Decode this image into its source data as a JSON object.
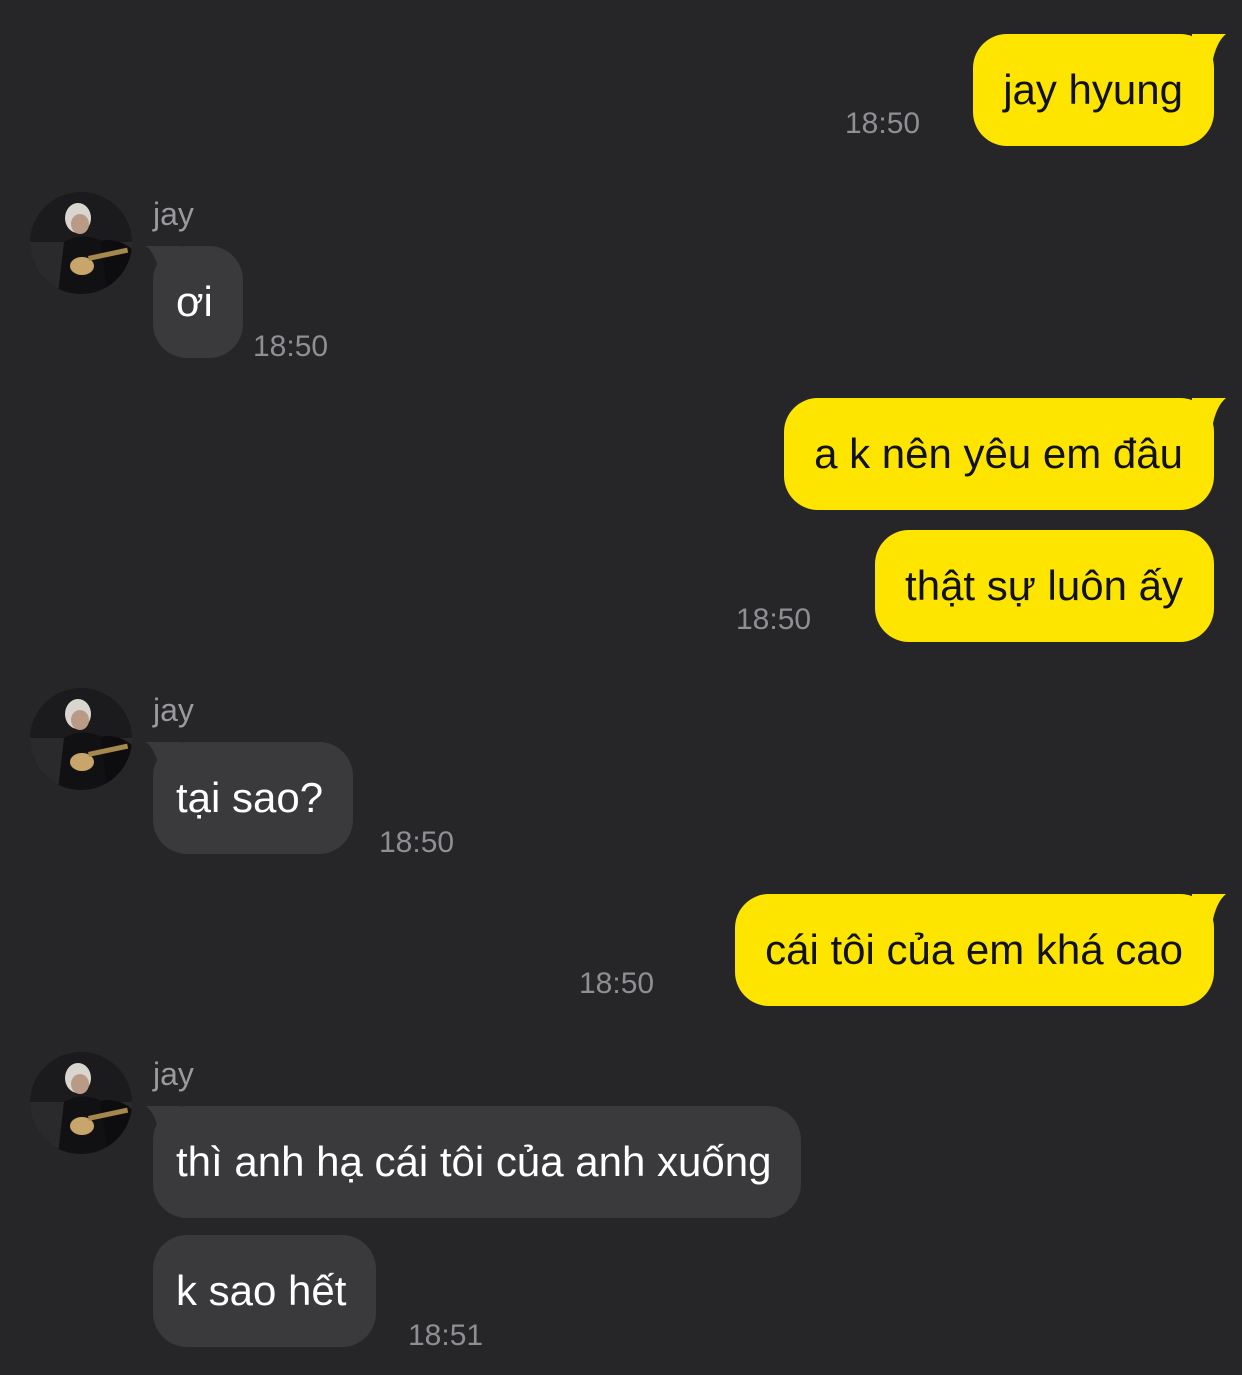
{
  "contact": {
    "name": "jay"
  },
  "messages": [
    {
      "side": "sent",
      "text": "jay hyung",
      "time": "18:50"
    },
    {
      "side": "received",
      "text": "ơi",
      "time": "18:50"
    },
    {
      "side": "sent",
      "text": "a k nên yêu em đâu"
    },
    {
      "side": "sent",
      "text": "thật sự luôn ấy",
      "time": "18:50"
    },
    {
      "side": "received",
      "text": "tại sao?",
      "time": "18:50"
    },
    {
      "side": "sent",
      "text": "cái tôi của em khá cao",
      "time": "18:50"
    },
    {
      "side": "received",
      "text": "thì anh hạ cái tôi của anh xuống"
    },
    {
      "side": "received",
      "text": "k sao hết",
      "time": "18:51"
    }
  ],
  "colors": {
    "background": "#262628",
    "sent_bubble": "#fee500",
    "received_bubble": "#3a3a3c",
    "timestamp": "#8e8e93"
  },
  "icons": {
    "avatar": "profile-photo-avatar"
  }
}
